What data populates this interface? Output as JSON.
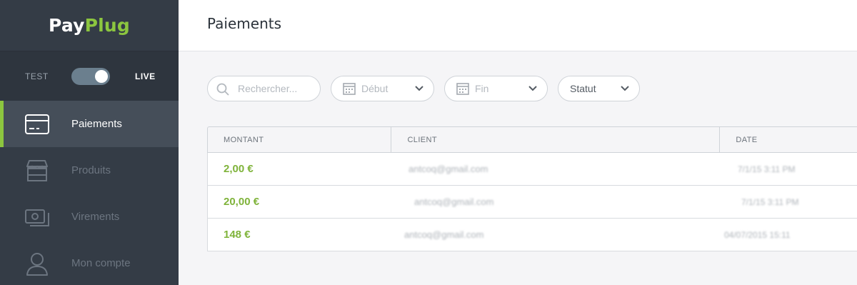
{
  "brand": {
    "pay": "Pay",
    "plug": "Plug",
    "accent": "#8cc63f"
  },
  "mode": {
    "test_label": "TEST",
    "live_label": "LIVE",
    "live_enabled": true
  },
  "sidebar": {
    "items": [
      {
        "label": "Paiements",
        "icon": "credit-card-icon",
        "active": true
      },
      {
        "label": "Produits",
        "icon": "storefront-icon",
        "active": false
      },
      {
        "label": "Virements",
        "icon": "banknotes-icon",
        "active": false
      },
      {
        "label": "Mon compte",
        "icon": "user-icon",
        "active": false
      }
    ]
  },
  "header": {
    "title": "Paiements"
  },
  "filters": {
    "search_placeholder": "Rechercher...",
    "start_label": "Début",
    "end_label": "Fin",
    "status_label": "Statut"
  },
  "table": {
    "columns": [
      "MONTANT",
      "CLIENT",
      "DATE"
    ],
    "rows": [
      {
        "amount": "2,00 €",
        "client": "antcoq@gmail.com",
        "date": "7/1/15 3:11 PM"
      },
      {
        "amount": "20,00 €",
        "client": "antcoq@gmail.com",
        "date": "7/1/15 3:11 PM"
      },
      {
        "amount": "148 €",
        "client": "antcoq@gmail.com",
        "date": "04/07/2015 15:11"
      }
    ]
  }
}
